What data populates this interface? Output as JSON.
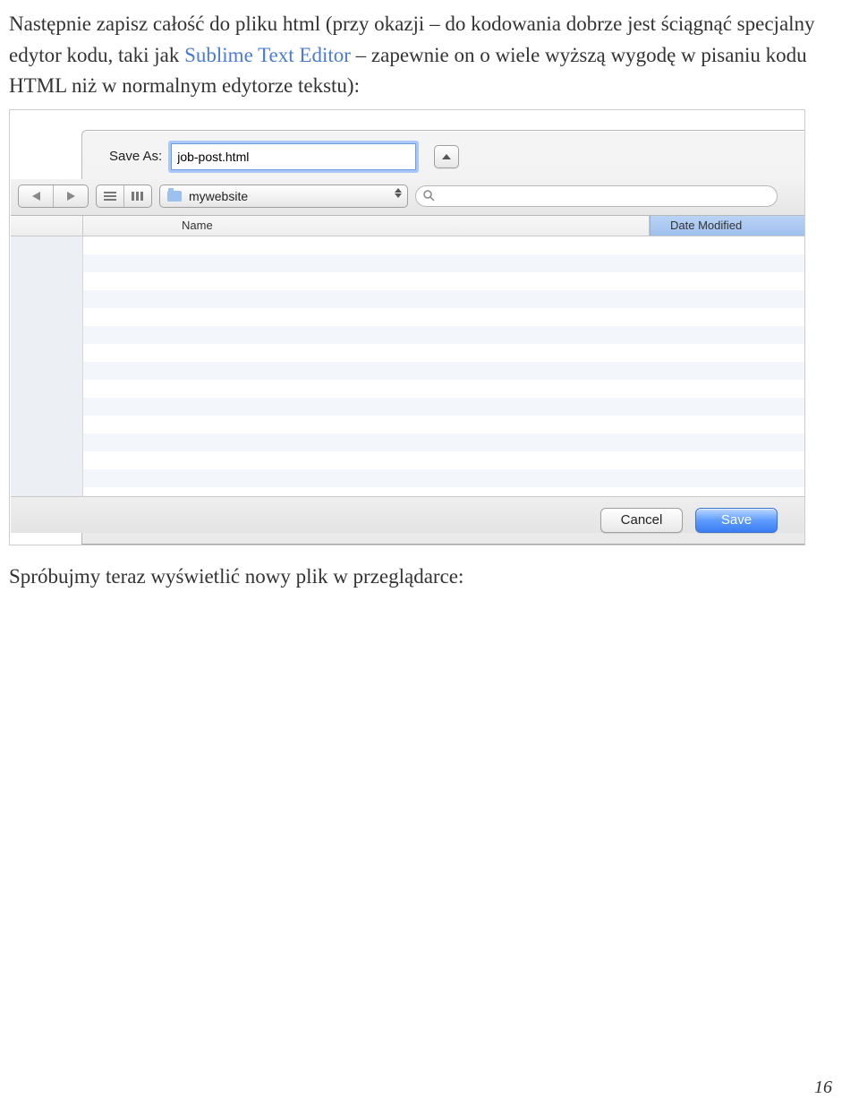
{
  "para1_part1": "Następnie zapisz całość do pliku html (przy okazji – do kodowania dobrze jest ściągnąć specjalny edytor kodu, taki jak ",
  "para1_link": "Sublime Text Editor",
  "para1_part2": " – zapewnie on o wiele wyższą wygodę w pisaniu kodu HTML niż w normalnym edytorze tekstu):",
  "dialog": {
    "save_as_label": "Save As:",
    "save_as_value": "job-post.html",
    "folder_name": "mywebsite",
    "col_name": "Name",
    "col_date": "Date Modified",
    "cancel": "Cancel",
    "save": "Save"
  },
  "para2": "Spróbujmy teraz wyświetlić nowy plik w przeglądarce:",
  "page_number": "16"
}
